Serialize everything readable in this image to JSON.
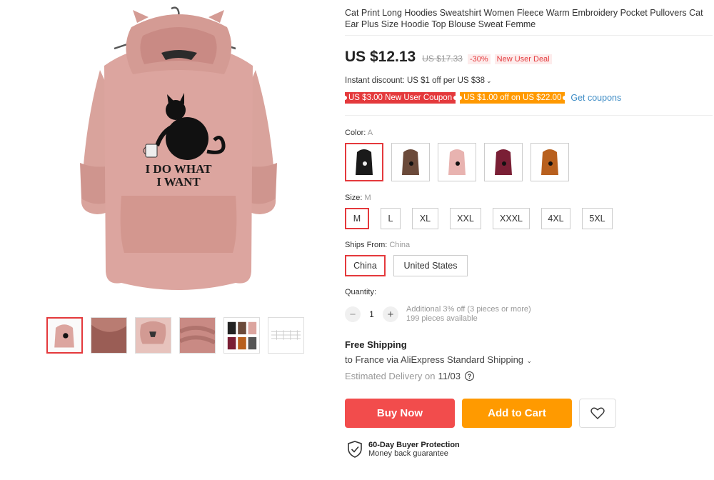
{
  "product": {
    "title": "Cat Print Long Hoodies Sweatshirt Women Fleece Warm Embroidery Pocket Pullovers Cat Ear Plus Size Hoodie Top Blouse Sweat Femme",
    "image_print_text_line1": "I DO WHAT",
    "image_print_text_line2": "I WANT",
    "thumbnails": [
      "thumb-hoodie",
      "thumb-fleece-closeup",
      "thumb-hood-detail",
      "thumb-fabric-texture",
      "thumb-color-variants",
      "thumb-size-chart"
    ]
  },
  "price": {
    "current": "US $12.13",
    "original": "US $17.33",
    "discount": "-30%",
    "deal_badge": "New User Deal"
  },
  "instant_discount": "Instant discount: US $1 off per US $38",
  "coupons": {
    "coupon1": "US $3.00 New User Coupon",
    "coupon2": "US $1.00 off on US $22.00",
    "get_label": "Get coupons"
  },
  "color": {
    "label": "Color:",
    "selected": "A",
    "swatches": [
      "#f0f0f0",
      "#6b4a3a",
      "#e8b3b0",
      "#7a1f35",
      "#b8601e"
    ]
  },
  "size": {
    "label": "Size:",
    "selected": "M",
    "options": [
      "M",
      "L",
      "XL",
      "XXL",
      "XXXL",
      "4XL",
      "5XL"
    ]
  },
  "ships_from": {
    "label": "Ships From:",
    "selected": "China",
    "options": [
      "China",
      "United States"
    ]
  },
  "quantity": {
    "label": "Quantity:",
    "value": "1",
    "minus": "−",
    "plus": "+",
    "note": "Additional 3% off (3 pieces or more)",
    "available": "199 pieces available"
  },
  "shipping": {
    "title": "Free Shipping",
    "line": "to France via AliExpress Standard Shipping",
    "eta_label": "Estimated Delivery on",
    "eta_date": "11/03",
    "help": "?"
  },
  "actions": {
    "buy": "Buy Now",
    "cart": "Add to Cart"
  },
  "protection": {
    "title": "60-Day Buyer Protection",
    "subtitle": "Money back guarantee"
  },
  "colors": {
    "accent_red": "#e4393c",
    "buy_red": "#f24c4c",
    "cart_orange": "#ff9a00",
    "link_blue": "#3f8dc6",
    "hoodie_pink": "#dca59f"
  }
}
